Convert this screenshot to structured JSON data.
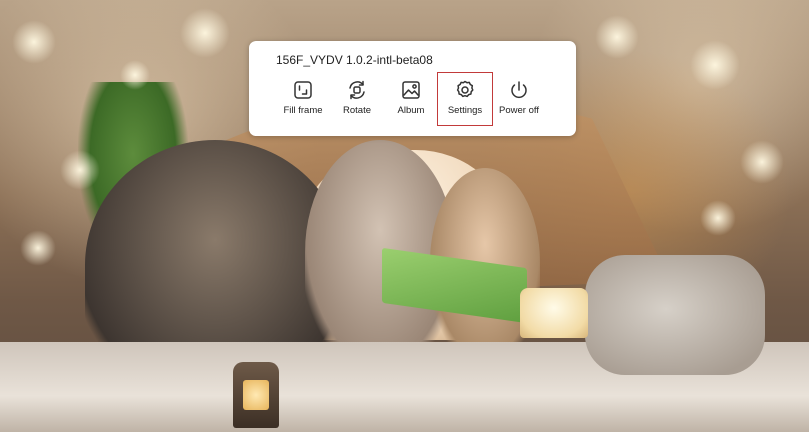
{
  "overlay": {
    "title": "156F_VYDV 1.0.2-intl-beta08",
    "items": [
      {
        "label": "Fill frame",
        "icon": "fill-frame-icon"
      },
      {
        "label": "Rotate",
        "icon": "rotate-icon"
      },
      {
        "label": "Album",
        "icon": "album-icon"
      },
      {
        "label": "Settings",
        "icon": "settings-icon",
        "selected": true
      },
      {
        "label": "Power off",
        "icon": "power-icon"
      }
    ],
    "selection_color": "#c23a3a"
  }
}
